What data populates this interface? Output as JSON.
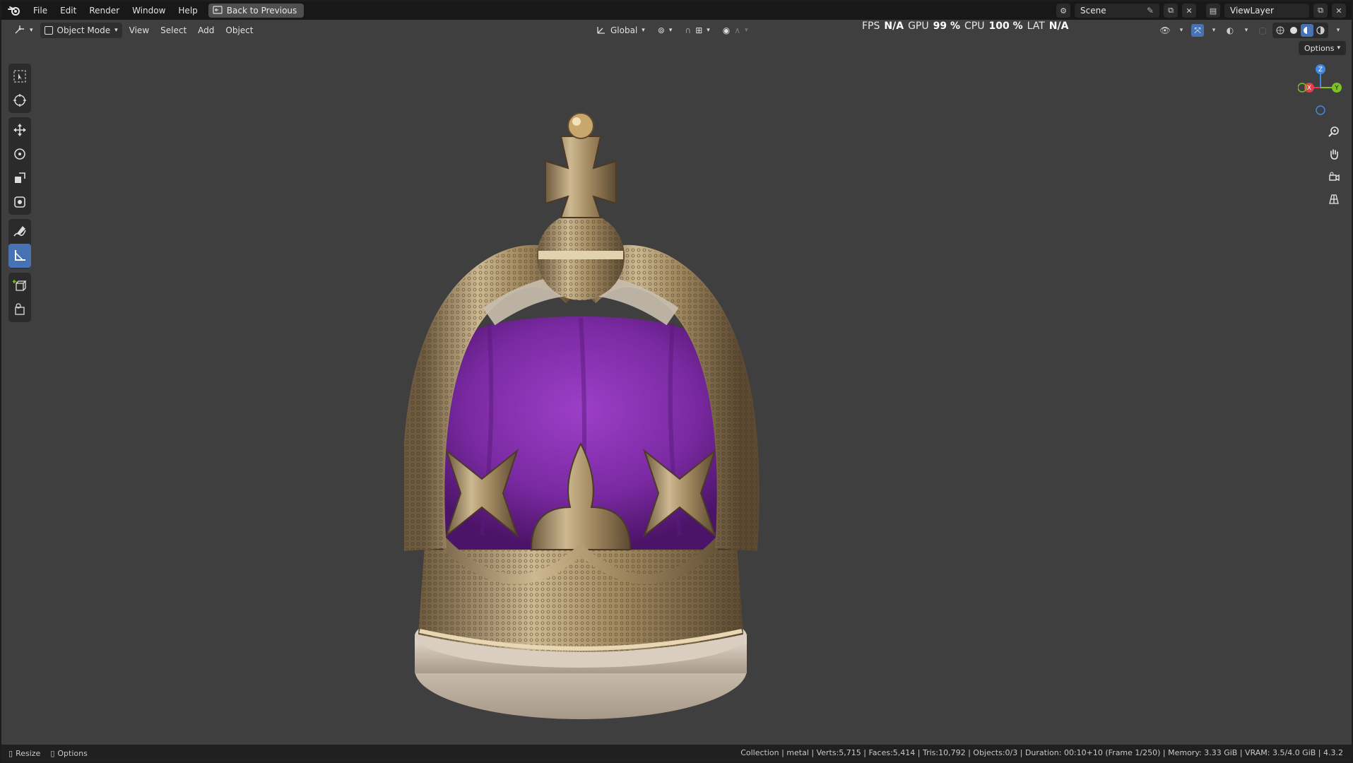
{
  "menubar": {
    "items": [
      "File",
      "Edit",
      "Render",
      "Window",
      "Help"
    ],
    "back_button": "Back to Previous",
    "scene": "Scene",
    "view_layer": "ViewLayer"
  },
  "header": {
    "mode": "Object Mode",
    "menus": [
      "View",
      "Select",
      "Add",
      "Object"
    ],
    "orientation": "Global"
  },
  "stats": {
    "fps_label": "FPS",
    "fps_value": "N/A",
    "gpu_label": "GPU",
    "gpu_value": "99 %",
    "cpu_label": "CPU",
    "cpu_value": "100 %",
    "lat_label": "LAT",
    "lat_value": "N/A"
  },
  "viewport": {
    "options_label": "Options",
    "gizmo_axes": {
      "z": "Z",
      "x": "X",
      "y": "Y"
    }
  },
  "statusbar": {
    "left": [
      "Resize",
      "Options"
    ],
    "info": "Collection | metal | Verts:5,715 | Faces:5,414 | Tris:10,792 | Objects:0/3 | Duration: 00:10+10 (Frame 1/250) | Memory: 3.33 GiB | VRAM: 3.5/4.0 GiB | 4.3.2"
  },
  "colors": {
    "accent": "#4772b3",
    "axis_x": "#e0404a",
    "axis_y": "#7cc324",
    "axis_z": "#3d8ae6",
    "velvet": "#7b2aa3",
    "gold": "#b8a078"
  },
  "icons": {
    "toolbar": [
      "select-box-icon",
      "cursor-icon",
      "move-icon",
      "rotate-icon",
      "scale-icon",
      "transform-icon",
      "annotate-icon",
      "measure-icon",
      "add-cube-icon",
      "add-object-icon"
    ],
    "navigation": [
      "zoom-icon",
      "pan-hand-icon",
      "camera-icon",
      "grid-icon"
    ]
  }
}
